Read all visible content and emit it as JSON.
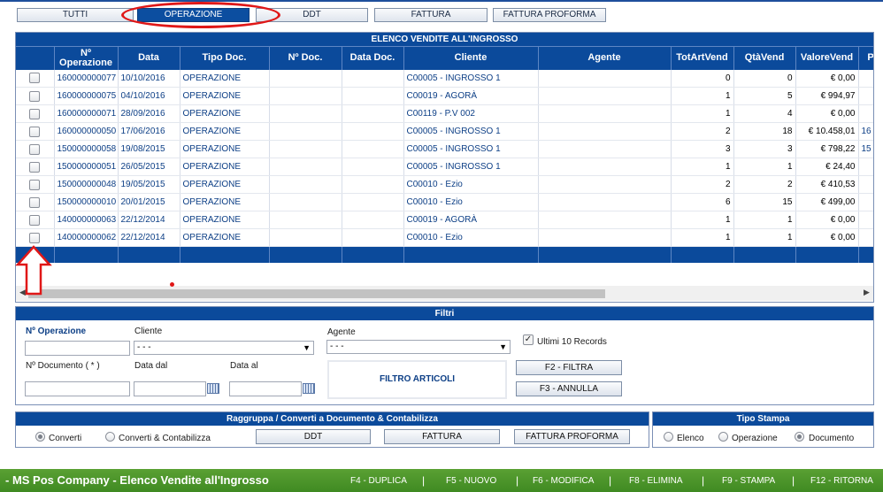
{
  "top_tabs": [
    {
      "label": "TUTTI",
      "active": false
    },
    {
      "label": "OPERAZIONE",
      "active": true
    },
    {
      "label": "DDT",
      "active": false
    },
    {
      "label": "FATTURA",
      "active": false
    },
    {
      "label": "FATTURA PROFORMA",
      "active": false
    }
  ],
  "grid": {
    "title": "ELENCO VENDITE ALL'INGROSSO",
    "columns": [
      "Nº Operazione",
      "Data",
      "Tipo Doc.",
      "Nº Doc.",
      "Data Doc.",
      "Cliente",
      "Agente",
      "TotArtVend",
      "QtàVend",
      "ValoreVend",
      "P"
    ],
    "rows": [
      {
        "num": "160000000077",
        "date": "10/10/2016",
        "tipo": "OPERAZIONE",
        "ndoc": "",
        "datadoc": "",
        "cliente": "C00005 - INGROSSO 1",
        "agente": "",
        "totart": "0",
        "qta": "0",
        "valore": "€ 0,00",
        "extra": ""
      },
      {
        "num": "160000000075",
        "date": "04/10/2016",
        "tipo": "OPERAZIONE",
        "ndoc": "",
        "datadoc": "",
        "cliente": "C00019 - AGORÀ",
        "agente": "",
        "totart": "1",
        "qta": "5",
        "valore": "€ 994,97",
        "extra": ""
      },
      {
        "num": "160000000071",
        "date": "28/09/2016",
        "tipo": "OPERAZIONE",
        "ndoc": "",
        "datadoc": "",
        "cliente": "C00119 - P.V 002",
        "agente": "",
        "totart": "1",
        "qta": "4",
        "valore": "€ 0,00",
        "extra": ""
      },
      {
        "num": "160000000050",
        "date": "17/06/2016",
        "tipo": "OPERAZIONE",
        "ndoc": "",
        "datadoc": "",
        "cliente": "C00005 - INGROSSO 1",
        "agente": "",
        "totart": "2",
        "qta": "18",
        "valore": "€ 10.458,01",
        "extra": "16"
      },
      {
        "num": "150000000058",
        "date": "19/08/2015",
        "tipo": "OPERAZIONE",
        "ndoc": "",
        "datadoc": "",
        "cliente": "C00005 - INGROSSO 1",
        "agente": "",
        "totart": "3",
        "qta": "3",
        "valore": "€ 798,22",
        "extra": "15"
      },
      {
        "num": "150000000051",
        "date": "26/05/2015",
        "tipo": "OPERAZIONE",
        "ndoc": "",
        "datadoc": "",
        "cliente": "C00005 - INGROSSO 1",
        "agente": "",
        "totart": "1",
        "qta": "1",
        "valore": "€ 24,40",
        "extra": ""
      },
      {
        "num": "150000000048",
        "date": "19/05/2015",
        "tipo": "OPERAZIONE",
        "ndoc": "",
        "datadoc": "",
        "cliente": "C00010 - Ezio",
        "agente": "",
        "totart": "2",
        "qta": "2",
        "valore": "€ 410,53",
        "extra": ""
      },
      {
        "num": "150000000010",
        "date": "20/01/2015",
        "tipo": "OPERAZIONE",
        "ndoc": "",
        "datadoc": "",
        "cliente": "C00010 - Ezio",
        "agente": "",
        "totart": "6",
        "qta": "15",
        "valore": "€ 499,00",
        "extra": ""
      },
      {
        "num": "140000000063",
        "date": "22/12/2014",
        "tipo": "OPERAZIONE",
        "ndoc": "",
        "datadoc": "",
        "cliente": "C00019 - AGORÀ",
        "agente": "",
        "totart": "1",
        "qta": "1",
        "valore": "€ 0,00",
        "extra": ""
      },
      {
        "num": "140000000062",
        "date": "22/12/2014",
        "tipo": "OPERAZIONE",
        "ndoc": "",
        "datadoc": "",
        "cliente": "C00010 - Ezio",
        "agente": "",
        "totart": "1",
        "qta": "1",
        "valore": "€ 0,00",
        "extra": ""
      }
    ]
  },
  "filtri": {
    "title": "Filtri",
    "n_operazione_label": "Nº Operazione",
    "cliente_label": "Cliente",
    "cliente_value": "- - -",
    "agente_label": "Agente",
    "agente_value": "- - -",
    "ultimi_label": "Ultimi 10 Records",
    "ultimi_checked": true,
    "n_documento_label": "Nº Documento ( * )",
    "data_dal_label": "Data dal",
    "data_al_label": "Data al",
    "filtro_articoli": "FILTRO ARTICOLI",
    "filtra_button": "F2 - FILTRA",
    "annulla_button": "F3 - ANNULLA"
  },
  "raggruppa": {
    "title": "Raggruppa / Converti a Documento & Contabilizza",
    "converti_label": "Converti",
    "converti_cont_label": "Converti & Contabilizza",
    "selected": "Converti",
    "ddt_button": "DDT",
    "fattura_button": "FATTURA",
    "proforma_button": "FATTURA PROFORMA"
  },
  "tipo_stampa": {
    "title": "Tipo Stampa",
    "elenco": "Elenco",
    "operazione": "Operazione",
    "documento": "Documento",
    "selected": "Documento"
  },
  "statusbar": {
    "title": "- MS Pos Company - Elenco Vendite all'Ingrosso",
    "keys": [
      "F4 - DUPLICA",
      "F5 - NUOVO",
      "F6 - MODIFICA",
      "F8 - ELIMINA",
      "F9 - STAMPA",
      "F12 - RITORNA"
    ],
    "separator": "|"
  },
  "colors": {
    "header_blue": "#0b4a9b",
    "status_green": "#4a9a2a",
    "annotation_red": "#e01717"
  }
}
